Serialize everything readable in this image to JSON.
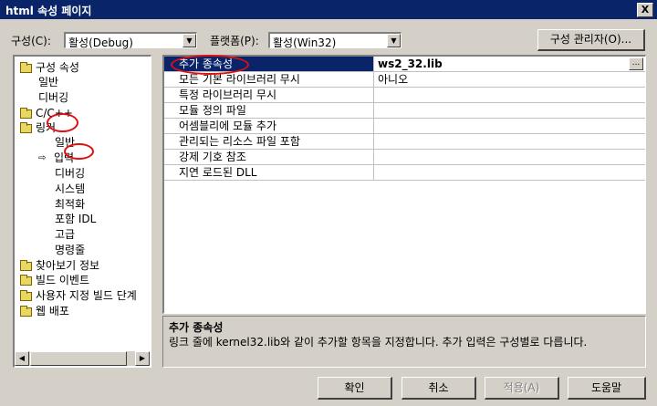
{
  "window": {
    "title": "html 속성 페이지",
    "close_glyph": "X"
  },
  "config": {
    "config_label": "구성(C):",
    "config_value": "활성(Debug)",
    "platform_label": "플랫폼(P):",
    "platform_value": "활성(Win32)",
    "manager_button": "구성 관리자(O)..."
  },
  "tree": [
    {
      "label": "구성 속성",
      "folder": true,
      "open": true
    },
    {
      "label": "일반"
    },
    {
      "label": "디버깅"
    },
    {
      "label": "C/C++",
      "folder": true
    },
    {
      "label": "링커",
      "folder": true,
      "open": true
    },
    {
      "label": "일반"
    },
    {
      "label": "입력",
      "selected_arrow": "⇨"
    },
    {
      "label": "디버깅"
    },
    {
      "label": "시스템"
    },
    {
      "label": "최적화"
    },
    {
      "label": "포함 IDL"
    },
    {
      "label": "고급"
    },
    {
      "label": "명령줄"
    },
    {
      "label": "찾아보기 정보",
      "folder": true
    },
    {
      "label": "빌드 이벤트",
      "folder": true
    },
    {
      "label": "사용자 지정 빌드 단계",
      "folder": true
    },
    {
      "label": "웹 배포",
      "folder": true
    }
  ],
  "grid": {
    "rows": [
      {
        "name": "추가 종속성",
        "value": "ws2_32.lib",
        "selected": true
      },
      {
        "name": "모든 기본 라이브러리 무시",
        "value": "아니오"
      },
      {
        "name": "특정 라이브러리 무시",
        "value": ""
      },
      {
        "name": "모듈 정의 파일",
        "value": ""
      },
      {
        "name": "어셈블리에 모듈 추가",
        "value": ""
      },
      {
        "name": "관리되는 리소스 파일 포함",
        "value": ""
      },
      {
        "name": "강제 기호 참조",
        "value": ""
      },
      {
        "name": "지연 로드된 DLL",
        "value": ""
      }
    ],
    "ellipsis_glyph": "..."
  },
  "description": {
    "title": "추가 종속성",
    "text": "링크 줄에 kernel32.lib와 같이 추가할 항목을 지정합니다. 추가 입력은 구성별로 다릅니다."
  },
  "buttons": {
    "ok": "확인",
    "cancel": "취소",
    "apply": "적용(A)",
    "help": "도움말"
  },
  "annotations": {
    "color": "#e01010"
  }
}
